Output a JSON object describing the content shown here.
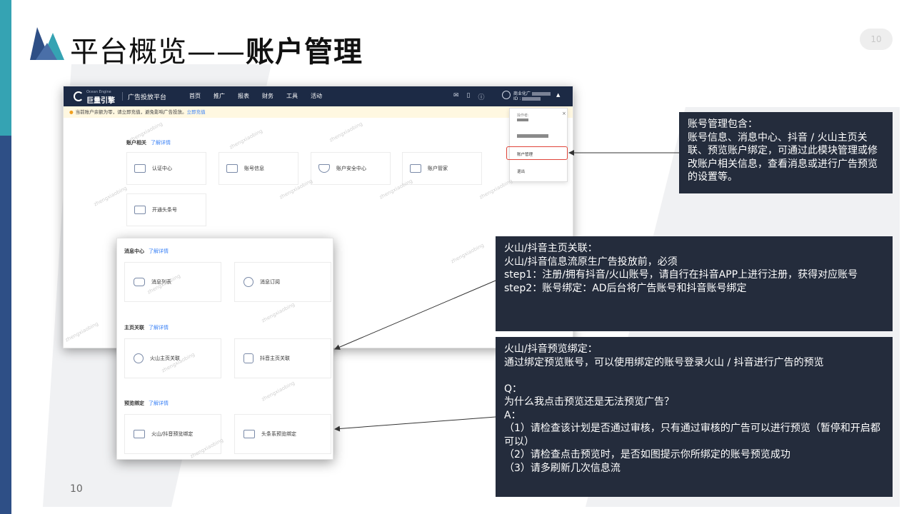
{
  "slide": {
    "title_normal": "平台概览——",
    "title_bold": "账户管理",
    "page_badge": "10",
    "page_number": "10"
  },
  "app": {
    "brand_en": "Ocean Engine",
    "brand_cn": "巨量引擎",
    "platform": "广告投放平台",
    "nav": [
      "首页",
      "推广",
      "报表",
      "财务",
      "工具",
      "活动"
    ],
    "icons": [
      "mail-icon",
      "phone-icon",
      "help-icon"
    ],
    "user_name_prefix": "商业化广",
    "user_id_prefix": "ID :",
    "notice_text": "当前账户余额为零，请立即充值，避免影响广告投放。",
    "notice_link": "立即充值",
    "account_section": "账户相关",
    "more": "了解详情",
    "account_cards": [
      "认证中心",
      "账号信息",
      "账户安全中心",
      "账户管家",
      "开通头条号"
    ],
    "dropdown": {
      "operator_label": "操作者:",
      "account_manage": "账户管理",
      "logout": "退出"
    },
    "watermark": "zhengxiaobing"
  },
  "sub": {
    "message_section": "消息中心",
    "message_cards": [
      "消息列表",
      "消息订阅"
    ],
    "homepage_section": "主页关联",
    "homepage_cards": [
      "火山主页关联",
      "抖音主页关联"
    ],
    "preview_section": "预览绑定",
    "preview_cards": [
      "火山/抖音预览绑定",
      "头条系预览绑定"
    ],
    "more": "了解详情"
  },
  "callouts": {
    "account": "账号管理包含：\n账号信息、消息中心、抖音 / 火山主页关联、预览账户绑定，可通过此模块管理或修改账户相关信息，查看消息或进行广告预览的设置等。",
    "homepage": "火山/抖音主页关联：\n火山/抖音信息流原生广告投放前，必须\nstep1：注册/拥有抖音/火山账号，请自行在抖音APP上进行注册，获得对应账号\nstep2：账号绑定：AD后台将广告账号和抖音账号绑定",
    "preview": "火山/抖音预览绑定：\n通过绑定预览账号，可以使用绑定的账号登录火山 / 抖音进行广告的预览\n\nQ：\n为什么我点击预览还是无法预览广告？\nA：\n（1）请检查该计划是否通过审核，只有通过审核的广告可以进行预览（暂停和开启都可以）\n（2）请检查点击预览时，是否如图提示你所绑定的账号预览成功\n（3）请多刷新几次信息流"
  },
  "colors": {
    "topbar": "#1c2a45",
    "link": "#3b82f6",
    "highlight": "#e0453a",
    "callout_bg": "#242c3c",
    "stripe_teal": "#35a3b3",
    "stripe_navy": "#2e4f86"
  }
}
